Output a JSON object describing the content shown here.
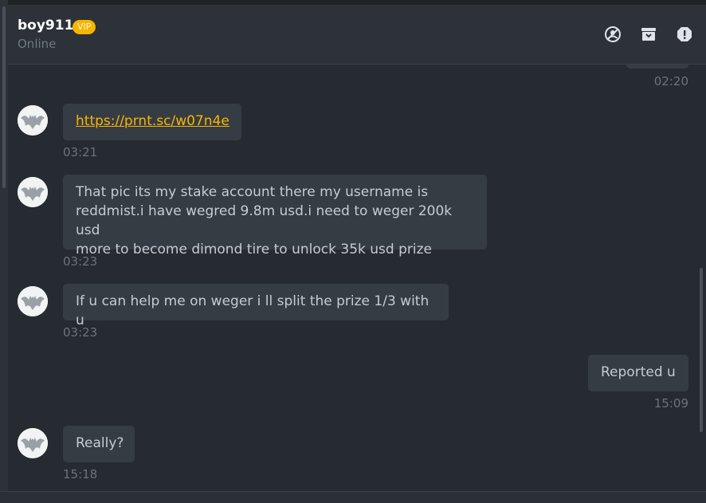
{
  "header": {
    "username": "boy911",
    "badge": "VIP",
    "status": "Online",
    "icons": [
      "block-icon",
      "archive-icon",
      "report-icon"
    ]
  },
  "colors": {
    "accent": "#f7b500",
    "bubble": "#363c43",
    "background": "#262b31"
  },
  "messages": [
    {
      "side": "right",
      "text": "",
      "time": "02:20"
    },
    {
      "side": "left",
      "text": "https://prnt.sc/w07n4e",
      "time": "03:21",
      "is_link": true
    },
    {
      "side": "left",
      "lines": [
        "That pic its my stake account there my username is",
        "reddmist.i have wegred 9.8m usd.i need to weger 200k usd",
        "more to become dimond tire to unlock 35k usd prize"
      ],
      "time": "03:23"
    },
    {
      "side": "left",
      "text": "If u can help me on weger i ll split the prize 1/3 with u",
      "time": "03:23"
    },
    {
      "side": "right",
      "text": "Reported u",
      "time": "15:09"
    },
    {
      "side": "left",
      "text": "Really?",
      "time": "15:18"
    }
  ]
}
